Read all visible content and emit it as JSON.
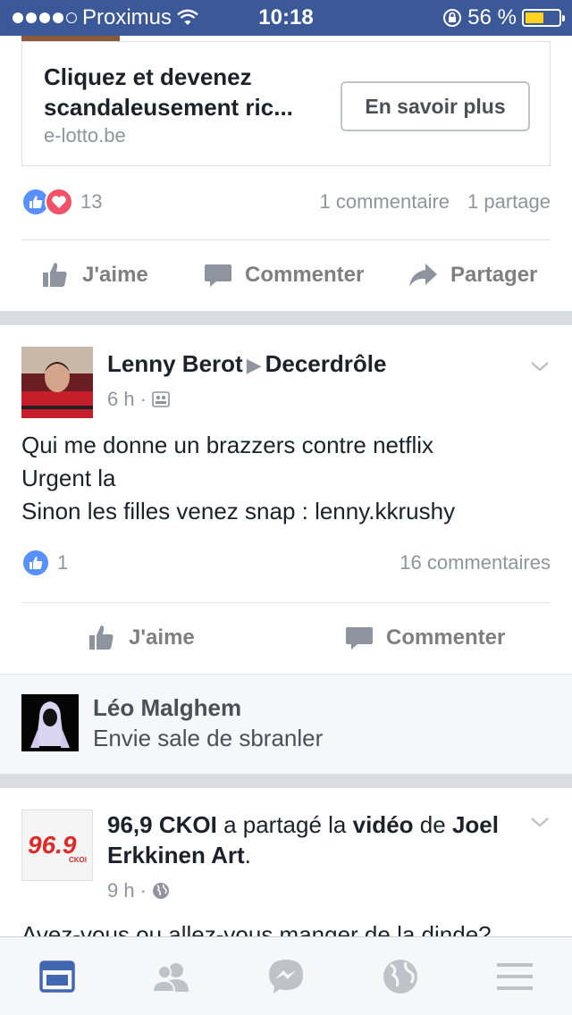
{
  "status_bar": {
    "carrier": "Proximus",
    "time": "10:18",
    "battery_percent": "56 %",
    "battery_level": 0.56
  },
  "ad": {
    "title_line1": "Cliquez et devenez",
    "title_line2": "scandaleusement ric...",
    "domain": "e-lotto.be",
    "cta": "En savoir plus"
  },
  "ad_stats": {
    "reactions": "13",
    "comments": "1 commentaire",
    "shares": "1 partage"
  },
  "actions": {
    "like": "J'aime",
    "comment": "Commenter",
    "share": "Partager"
  },
  "post1": {
    "author": "Lenny Berot",
    "group": "Decerdrôle",
    "time": "6 h",
    "text": "Qui me donne un brazzers contre netflix\nUrgent la\nSinon les filles venez snap : lenny.kkrushy",
    "likes": "1",
    "comments": "16 commentaires"
  },
  "suggestion": {
    "name": "Léo Malghem",
    "status": "Envie sale de sbranler"
  },
  "post2": {
    "author": "96,9 CKOI",
    "verb": "a partagé la",
    "object": "vidéo",
    "preposition": "de",
    "source": "Joel Erkkinen Art",
    "source_suffix": ".",
    "time": "9 h",
    "text": "Avez-vous ou allez-vous manger de la dinde?",
    "logo_text": "96.9",
    "logo_sub": "CKOI"
  },
  "colors": {
    "brand": "#3b5998",
    "like_blue": "#5890ff",
    "love_red": "#f25268"
  }
}
